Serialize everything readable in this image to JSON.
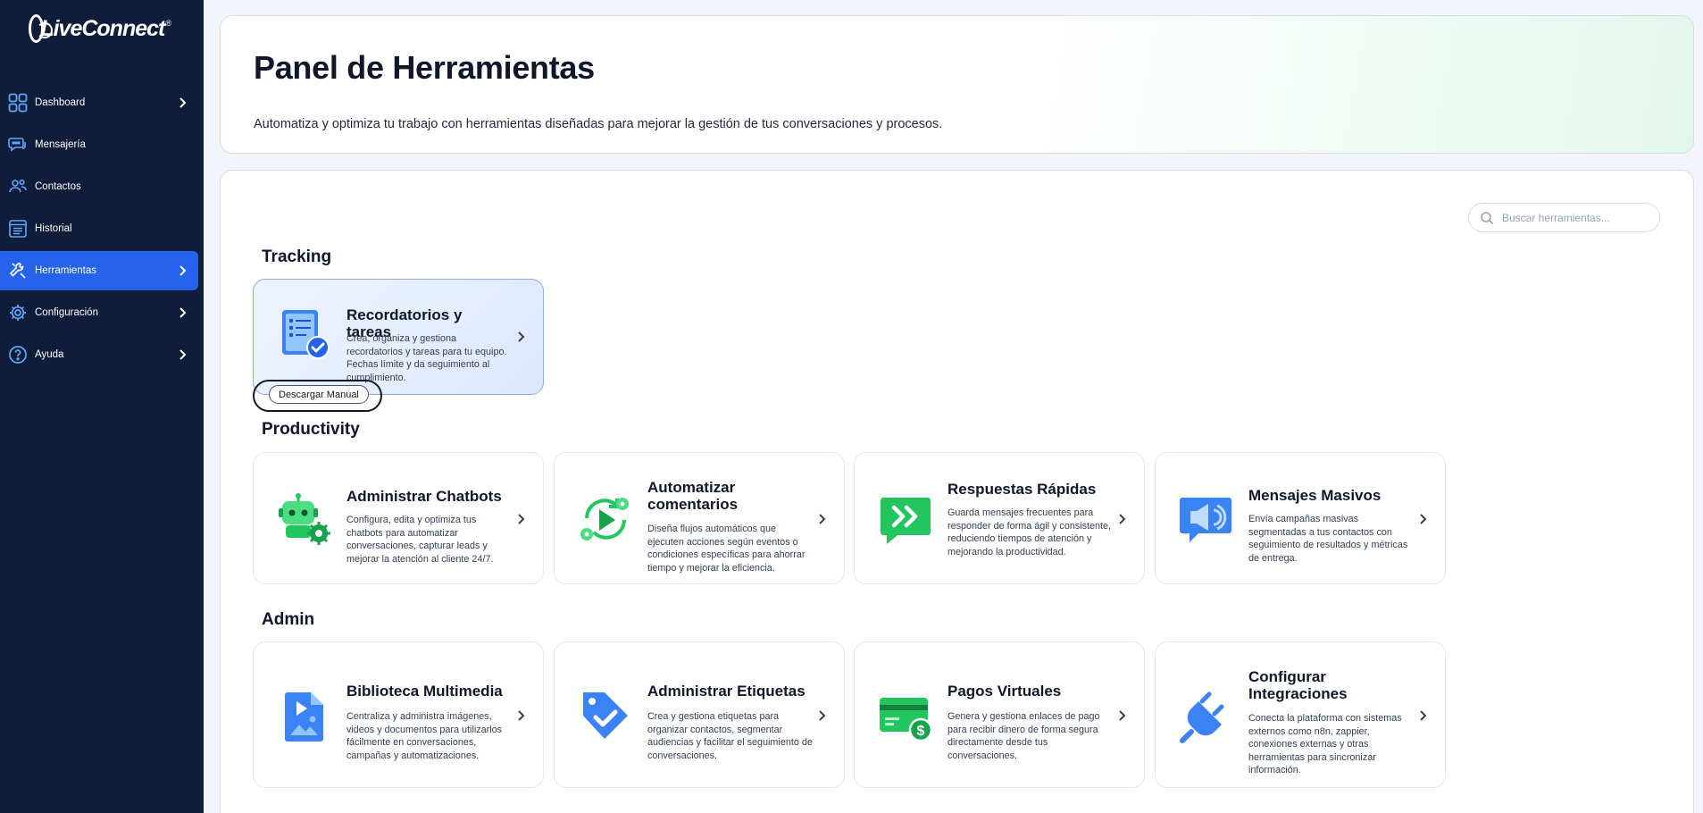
{
  "app": {
    "logo_text": "LiveConnect",
    "logo_mark": "®"
  },
  "sidebar": {
    "items": [
      {
        "label": "Dashboard",
        "icon": "grid-icon",
        "has_chevron": true
      },
      {
        "label": "Mensajería",
        "icon": "chat-bubbles-icon",
        "has_chevron": false
      },
      {
        "label": "Contactos",
        "icon": "users-icon",
        "has_chevron": false
      },
      {
        "label": "Historial",
        "icon": "history-list-icon",
        "has_chevron": false
      },
      {
        "label": "Herramientas",
        "icon": "tools-icon",
        "has_chevron": true,
        "active": true
      },
      {
        "label": "Configuración",
        "icon": "gear-icon",
        "has_chevron": true
      },
      {
        "label": "Ayuda",
        "icon": "help-circle-icon",
        "has_chevron": true
      }
    ]
  },
  "header": {
    "title": "Panel de Herramientas",
    "subtitle": "Automatiza y optimiza tu trabajo con herramientas diseñadas para mejorar la gestión de tus conversaciones y procesos."
  },
  "search": {
    "placeholder": "Buscar herramientas..."
  },
  "sections": {
    "tracking": {
      "title": "Tracking",
      "tools": [
        {
          "title": "Recordatorios y tareas",
          "description": "Crea, organiza y gestiona recordatorios y tareas para tu equipo. Fechas límite y da seguimiento al cumplimiento.",
          "icon": "task-list-check-icon"
        }
      ],
      "manual_button": "Descargar Manual"
    },
    "productivity": {
      "title": "Productivity",
      "tools": [
        {
          "title": "Administrar Chatbots",
          "description": "Configura, edita y optimiza tus chatbots para automatizar conversaciones, capturar leads y mejorar la atención al cliente 24/7.",
          "icon": "robot-gear-icon"
        },
        {
          "title": "Automatizar comentarios",
          "description": "Diseña flujos automáticos que ejecuten acciones según eventos o condiciones específicas para ahorrar tiempo y mejorar la eficiencia.",
          "icon": "automation-play-icon"
        },
        {
          "title": "Respuestas Rápidas",
          "description": "Guarda mensajes frecuentes para responder de forma ágil y consistente, reduciendo tiempos de atención y mejorando la productividad.",
          "icon": "quick-reply-icon"
        },
        {
          "title": "Mensajes Masivos",
          "description": "Envía campañas masivas segmentadas a tus contactos con seguimiento de resultados y métricas de entrega.",
          "icon": "megaphone-icon"
        }
      ]
    },
    "admin": {
      "title": "Admin",
      "tools": [
        {
          "title": "Biblioteca Multimedia",
          "description": "Centraliza y administra imágenes, videos y documentos para utilizarlos fácilmente en conversaciones, campañas y automatizaciones.",
          "icon": "media-file-icon"
        },
        {
          "title": "Administrar Etiquetas",
          "description": "Crea y gestiona etiquetas para organizar contactos, segmentar audiencias y facilitar el seguimiento de conversaciones.",
          "icon": "tag-check-icon"
        },
        {
          "title": "Pagos Virtuales",
          "description": "Genera y gestiona enlaces de pago para recibir dinero de forma segura directamente desde tus conversaciones.",
          "icon": "credit-card-dollar-icon"
        },
        {
          "title": "Configurar Integraciones",
          "description": "Conecta la plataforma con sistemas externos como n8n, zappier, conexiones externas y otras herramientas para sincronizar información.",
          "icon": "plug-icon"
        }
      ]
    }
  },
  "colors": {
    "sidebar_bg": "#0f1d3a",
    "active_accent": "#2563eb",
    "icon_blue": "#3b82f6",
    "icon_green": "#22c55e"
  }
}
